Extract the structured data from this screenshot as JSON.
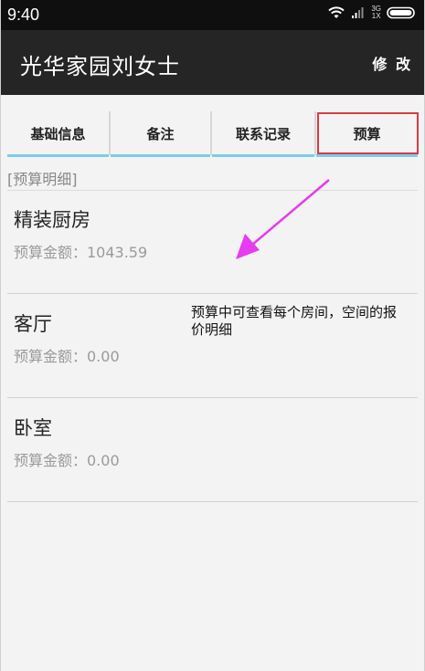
{
  "status_bar": {
    "time": "9:40",
    "network_label_top": "3G",
    "network_label_bottom": "1X"
  },
  "action_bar": {
    "title": "光华家园刘女士",
    "edit_label": "修 改"
  },
  "tabs": [
    {
      "label": "基础信息",
      "active": false
    },
    {
      "label": "备注",
      "active": false
    },
    {
      "label": "联系记录",
      "active": false
    },
    {
      "label": "预算",
      "active": true
    }
  ],
  "section_header": "[预算明细]",
  "rooms": [
    {
      "name": "精装厨房",
      "amount_text": "预算金额：1043.59"
    },
    {
      "name": "客厅",
      "amount_text": "预算金额：0.00"
    },
    {
      "name": "卧室",
      "amount_text": "预算金额：0.00"
    }
  ],
  "annotation": {
    "text": "预算中可查看每个房间，空间的报价明细",
    "arrow_color": "#e63bf0",
    "highlight_color": "#d63b45"
  },
  "colors": {
    "tab_underline": "#7ecbe9",
    "action_bar": "#252525",
    "status_bar": "#0f0f0f"
  }
}
